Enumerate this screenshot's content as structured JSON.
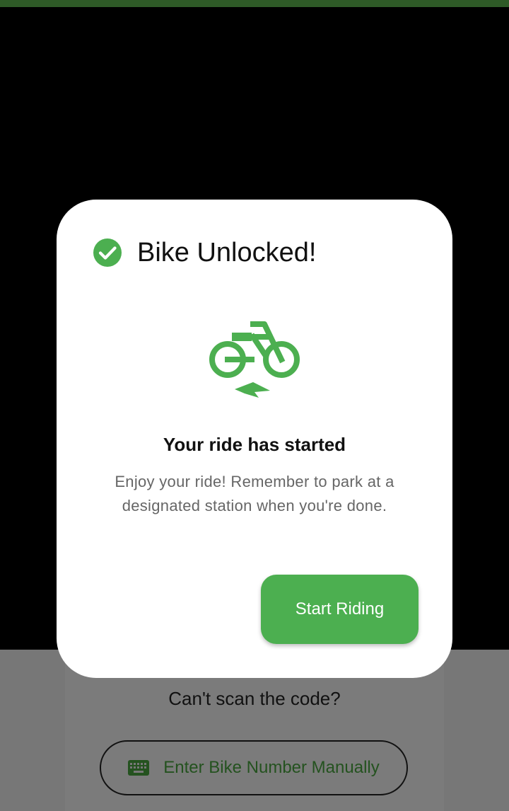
{
  "dialog": {
    "title": "Bike Unlocked!",
    "subtitle": "Your ride has started",
    "message": "Enjoy your ride! Remember to park at a designated station when you're done.",
    "start_button_label": "Start Riding",
    "icons": {
      "title_icon": "check-circle-icon",
      "hero_icon": "electric-bike-icon"
    }
  },
  "background_screen": {
    "cant_scan_text": "Can't scan the code?",
    "manual_entry_label": "Enter Bike Number Manually",
    "manual_entry_icon": "keyboard-icon"
  },
  "colors": {
    "accent": "#4caf50",
    "dark_green": "#24521f",
    "top_bar": "#2e5a27",
    "backdrop": "#000000"
  }
}
